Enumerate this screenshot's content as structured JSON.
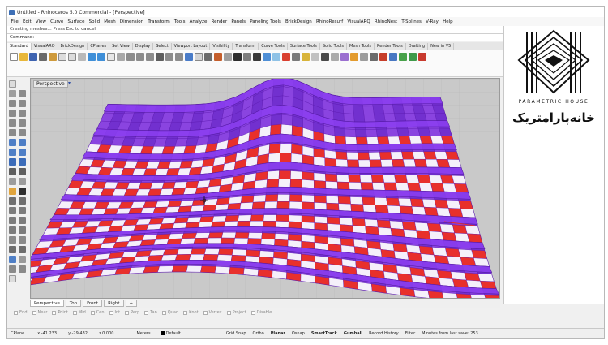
{
  "window": {
    "title": "Untitled - Rhinoceros 5.0 Commercial - [Perspective]"
  },
  "menubar": {
    "items": [
      "File",
      "Edit",
      "View",
      "Curve",
      "Surface",
      "Solid",
      "Mesh",
      "Dimension",
      "Transform",
      "Tools",
      "Analyze",
      "Render",
      "Panels",
      "Paneling Tools",
      "BrickDesign",
      "RhinoResurf",
      "VisualARQ",
      "RhinoNest",
      "T-Splines",
      "V-Ray",
      "Help"
    ]
  },
  "command": {
    "history": "Creating meshes... Press Esc to cancel",
    "label": "Command:",
    "value": ""
  },
  "toolbar_tabs": [
    "Standard",
    "VisualARQ",
    "BrickDesign",
    "CPlanes",
    "Set View",
    "Display",
    "Select",
    "Viewport Layout",
    "Visibility",
    "Transform",
    "Curve Tools",
    "Surface Tools",
    "Solid Tools",
    "Mesh Tools",
    "Render Tools",
    "Drafting",
    "New in V5"
  ],
  "viewport": {
    "label": "Perspective",
    "menu_glyph": "▾"
  },
  "right_panel": {
    "logo_subtitle": "PARAMETRIC HOUSE",
    "logo_script": "خانه‌پارامتریک"
  },
  "viewport_tabs": [
    "Perspective",
    "Top",
    "Front",
    "Right",
    "+"
  ],
  "osnaps": [
    "End",
    "Near",
    "Point",
    "Mid",
    "Cen",
    "Int",
    "Perp",
    "Tan",
    "Quad",
    "Knot",
    "Vertex",
    "Project",
    "Disable"
  ],
  "status": {
    "cplane": "CPlane",
    "x": "x -41.233",
    "y": "y -29.432",
    "z": "z 0.000",
    "units": "Meters",
    "layer": "Default",
    "grid_snap": "Grid Snap",
    "ortho": "Ortho",
    "planar": "Planar",
    "osnap": "Osnap",
    "smarttrack": "SmartTrack",
    "gumball": "Gumball",
    "record_history": "Record History",
    "filter": "Filter",
    "message": "Minutes from last save: 253"
  },
  "colors": {
    "surface_purple": "#7a2fd6",
    "panel_red": "#e8302c",
    "viewport_bg": "#c9c9c9"
  }
}
